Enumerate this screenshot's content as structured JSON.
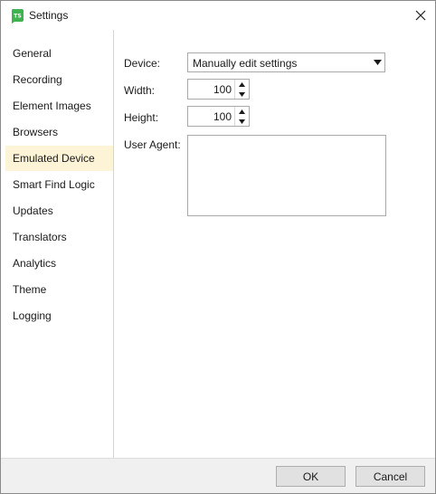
{
  "window": {
    "title": "Settings",
    "icon": "app-logo-icon",
    "icon_label": "TS",
    "accent_color": "#3fb34f"
  },
  "sidebar": {
    "items": [
      {
        "label": "General",
        "selected": false
      },
      {
        "label": "Recording",
        "selected": false
      },
      {
        "label": "Element Images",
        "selected": false
      },
      {
        "label": "Browsers",
        "selected": false
      },
      {
        "label": "Emulated Device",
        "selected": true
      },
      {
        "label": "Smart Find Logic",
        "selected": false
      },
      {
        "label": "Updates",
        "selected": false
      },
      {
        "label": "Translators",
        "selected": false
      },
      {
        "label": "Analytics",
        "selected": false
      },
      {
        "label": "Theme",
        "selected": false
      },
      {
        "label": "Logging",
        "selected": false
      }
    ],
    "selected_color": "#fdf3d7"
  },
  "form": {
    "device_label": "Device:",
    "device_value": "Manually edit settings",
    "width_label": "Width:",
    "width_value": "100",
    "height_label": "Height:",
    "height_value": "100",
    "user_agent_label": "User Agent:",
    "user_agent_value": ""
  },
  "footer": {
    "ok_label": "OK",
    "cancel_label": "Cancel"
  }
}
